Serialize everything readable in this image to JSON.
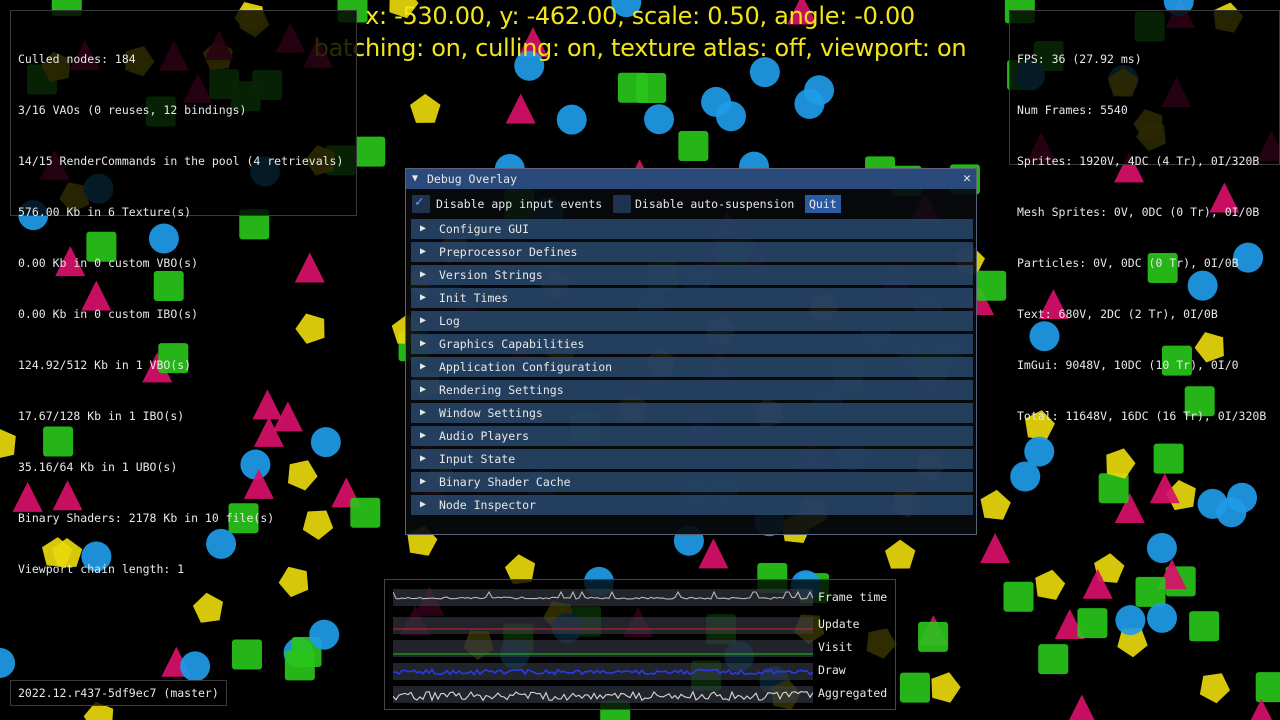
{
  "hud": {
    "line1": "x: -530.00, y: -462.00, scale: 0.50, angle: -0.00",
    "line2": "batching: on, culling: on, texture atlas: off, viewport: on",
    "color": "#f2e51a"
  },
  "stats_left": [
    "Culled nodes: 184",
    "3/16 VAOs (0 reuses, 12 bindings)",
    "14/15 RenderCommands in the pool (4 retrievals)",
    "576.00 Kb in 6 Texture(s)",
    "0.00 Kb in 0 custom VBO(s)",
    "0.00 Kb in 0 custom IBO(s)",
    "124.92/512 Kb in 1 VBO(s)",
    "17.67/128 Kb in 1 IBO(s)",
    "35.16/64 Kb in 1 UBO(s)",
    "Binary Shaders: 2178 Kb in 10 file(s)",
    "Viewport chain length: 1"
  ],
  "stats_right": [
    "FPS: 36 (27.92 ms)",
    "Num Frames: 5540",
    "Sprites: 1920V, 4DC (4 Tr), 0I/320B",
    "Mesh Sprites: 0V, 0DC (0 Tr), 0I/0B",
    "Particles: 0V, 0DC (0 Tr), 0I/0B",
    "Text: 680V, 2DC (2 Tr), 0I/0B",
    "ImGui: 9048V, 10DC (10 Tr), 0I/0",
    "Total: 11648V, 16DC (16 Tr), 0I/320B"
  ],
  "debug_window": {
    "title": "Debug Overlay",
    "collapse_glyph": "▼",
    "close_glyph": "✕",
    "options": {
      "disable_input_label": "Disable app input events",
      "disable_input_checked": true,
      "disable_suspension_label": "Disable auto-suspension",
      "disable_suspension_checked": false,
      "quit_label": "Quit"
    },
    "sections": [
      {
        "label": "Configure GUI"
      },
      {
        "label": "Preprocessor Defines"
      },
      {
        "label": "Version Strings"
      },
      {
        "label": "Init Times"
      },
      {
        "label": "Log"
      },
      {
        "label": "Graphics Capabilities"
      },
      {
        "label": "Application Configuration"
      },
      {
        "label": "Rendering Settings"
      },
      {
        "label": "Window Settings"
      },
      {
        "label": "Audio Players"
      },
      {
        "label": "Input State"
      },
      {
        "label": "Binary Shader Cache"
      },
      {
        "label": "Node Inspector"
      }
    ],
    "expand_glyph": "▶"
  },
  "perf_graphs": [
    {
      "label": "Frame time",
      "color": "#b8b8b8"
    },
    {
      "label": "Update",
      "color": "#d0202a"
    },
    {
      "label": "Visit",
      "color": "#22c022"
    },
    {
      "label": "Draw",
      "color": "#2a3ae8"
    },
    {
      "label": "Aggregated",
      "color": "#d8d8d8"
    }
  ],
  "version": "2022.12.r437-5df9ec7 (master)",
  "colors": {
    "title_bar": "#294a7a",
    "section_header": "#2b4a70",
    "checkbox_tick": "#5fa8f0",
    "button": "#2a5aa0",
    "shape_circle": "#1e9be8",
    "shape_square": "#29c41a",
    "shape_triangle": "#d8106a",
    "shape_pentagon": "#e8d80c"
  }
}
